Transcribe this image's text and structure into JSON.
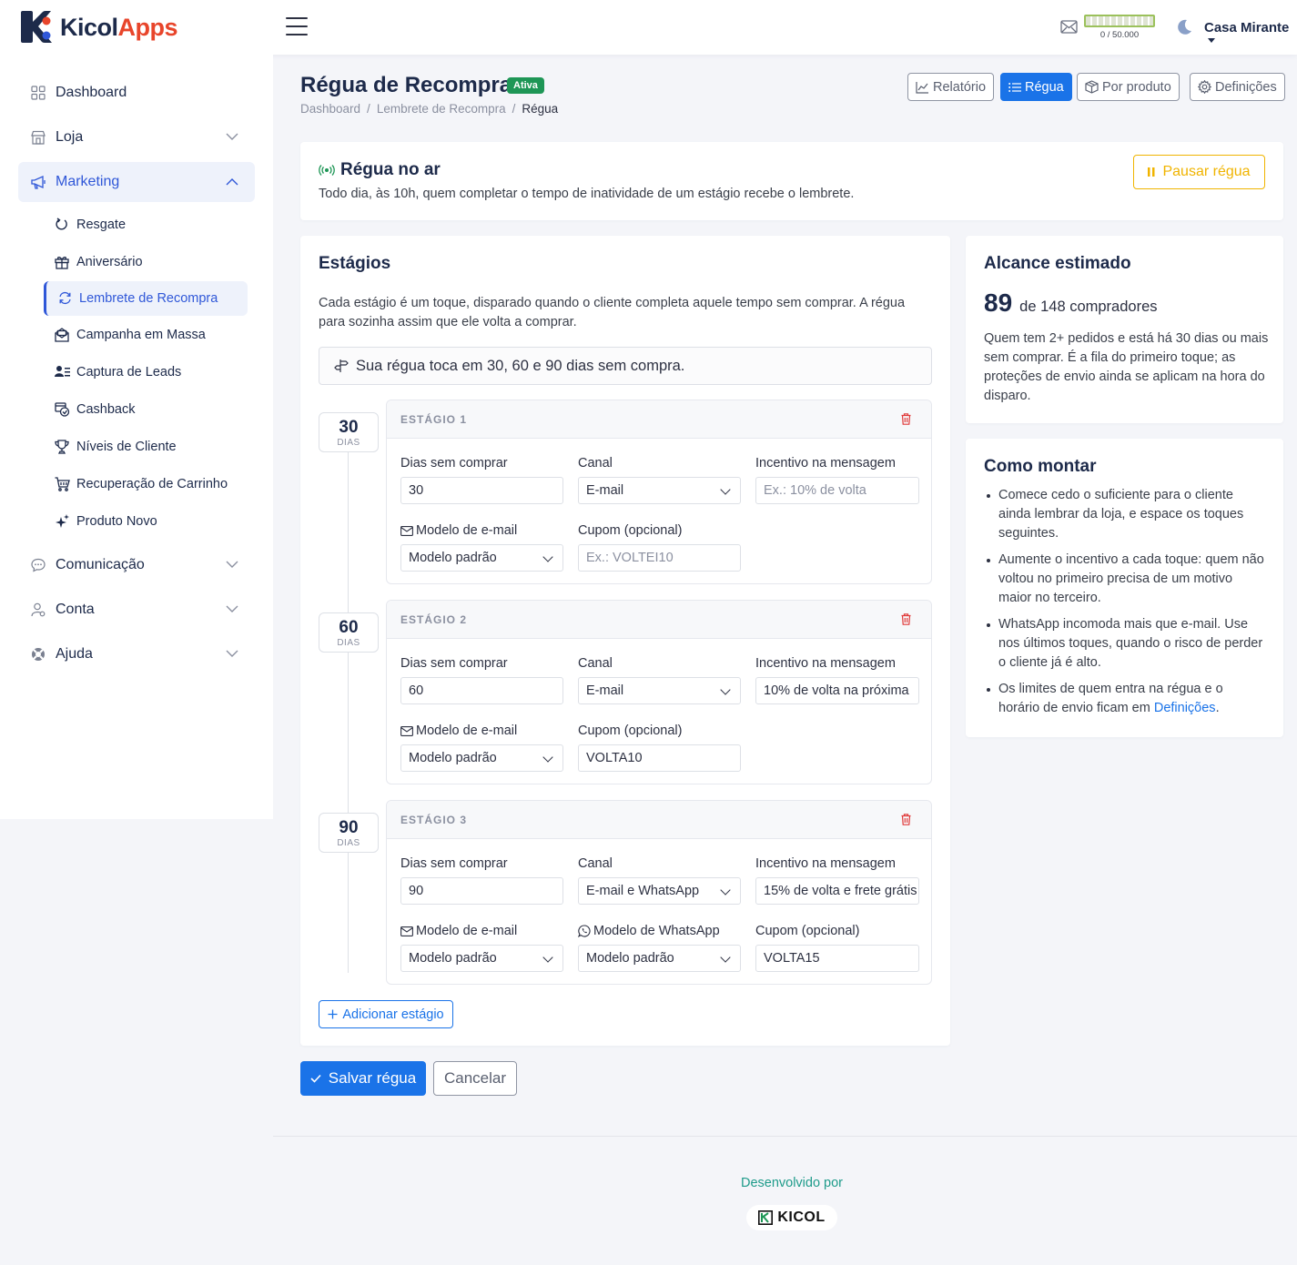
{
  "brand": {
    "name_part1": "Kicol",
    "name_part2": "Apps",
    "accent": "#e8452b",
    "navy": "#1d2a4a"
  },
  "header": {
    "email_quota": "0 / 50.000",
    "user": "Casa Mirante"
  },
  "sidebar": {
    "items": [
      {
        "label": "Dashboard",
        "icon": "grid-icon"
      },
      {
        "label": "Loja",
        "icon": "store-icon"
      },
      {
        "label": "Marketing",
        "icon": "megaphone-icon",
        "expanded": true
      },
      {
        "label": "Comunicação",
        "icon": "chat-icon"
      },
      {
        "label": "Conta",
        "icon": "user-icon"
      },
      {
        "label": "Ajuda",
        "icon": "lifebuoy-icon"
      }
    ],
    "marketing_sub": [
      {
        "label": "Resgate",
        "icon": "power-icon"
      },
      {
        "label": "Aniversário",
        "icon": "gift-icon"
      },
      {
        "label": "Lembrete de Recompra",
        "icon": "refresh-icon",
        "active": true
      },
      {
        "label": "Campanha em Massa",
        "icon": "envelope-icon"
      },
      {
        "label": "Captura de Leads",
        "icon": "user-list-icon"
      },
      {
        "label": "Cashback",
        "icon": "cashback-icon"
      },
      {
        "label": "Níveis de Cliente",
        "icon": "trophy-icon"
      },
      {
        "label": "Recuperação de Carrinho",
        "icon": "cart-icon"
      },
      {
        "label": "Produto Novo",
        "icon": "sparkle-icon"
      }
    ]
  },
  "page": {
    "title": "Régua de Recompra",
    "badge": "Ativa",
    "breadcrumb": [
      "Dashboard",
      "Lembrete de Recompra",
      "Régua"
    ],
    "breadcrumb_sep": "/",
    "tabs": [
      "Relatório",
      "Régua",
      "Por produto",
      "Definições"
    ],
    "active_tab": "Régua"
  },
  "status": {
    "title": "Régua no ar",
    "description": "Todo dia, às 10h, quem completar o tempo de inatividade de um estágio recebe o lembrete.",
    "pause_label": "Pausar régua"
  },
  "stages_card": {
    "title": "Estágios",
    "description": "Cada estágio é um toque, disparado quando o cliente completa aquele tempo sem comprar. A régua para sozinha assim que ele volta a comprar.",
    "summary": "Sua régua toca em 30, 60 e 90 dias sem compra.",
    "days_unit": "DIAS",
    "labels": {
      "days": "Dias sem comprar",
      "channel": "Canal",
      "incentive": "Incentivo na mensagem",
      "email_template": "Modelo de e-mail",
      "whatsapp_template": "Modelo de WhatsApp",
      "coupon": "Cupom (opcional)"
    },
    "stages": [
      {
        "header": "ESTÁGIO 1",
        "days": "30",
        "channel": "E-mail",
        "incentive": "",
        "incentive_placeholder": "Ex.: 10% de volta",
        "email_template": "Modelo padrão",
        "coupon": "",
        "coupon_placeholder": "Ex.: VOLTEI10"
      },
      {
        "header": "ESTÁGIO 2",
        "days": "60",
        "channel": "E-mail",
        "incentive": "10% de volta na próxima",
        "email_template": "Modelo padrão",
        "coupon": "VOLTA10"
      },
      {
        "header": "ESTÁGIO 3",
        "days": "90",
        "channel": "E-mail e WhatsApp",
        "incentive": "15% de volta e frete grátis",
        "email_template": "Modelo padrão",
        "whatsapp_template": "Modelo padrão",
        "coupon": "VOLTA15"
      }
    ],
    "add_label": "Adicionar estágio"
  },
  "reach": {
    "title": "Alcance estimado",
    "count": "89",
    "of_text": "de 148 compradores",
    "description": "Quem tem 2+ pedidos e está há 30 dias ou mais sem comprar. É a fila do primeiro toque; as proteções de envio ainda se aplicam na hora do disparo."
  },
  "howto": {
    "title": "Como montar",
    "tips": [
      "Comece cedo o suficiente para o cliente ainda lembrar da loja, e espace os toques seguintes.",
      "Aumente o incentivo a cada toque: quem não voltou no primeiro precisa de um motivo maior no terceiro.",
      "WhatsApp incomoda mais que e-mail. Use nos últimos toques, quando o risco de perder o cliente já é alto."
    ],
    "last_tip_prefix": "Os limites de quem entra na régua e o horário de envio ficam em ",
    "last_tip_link": "Definições",
    "last_tip_suffix": "."
  },
  "actions": {
    "save": "Salvar régua",
    "cancel": "Cancelar"
  },
  "footer": {
    "developed_by": "Desenvolvido por",
    "brand": "KICOL"
  }
}
